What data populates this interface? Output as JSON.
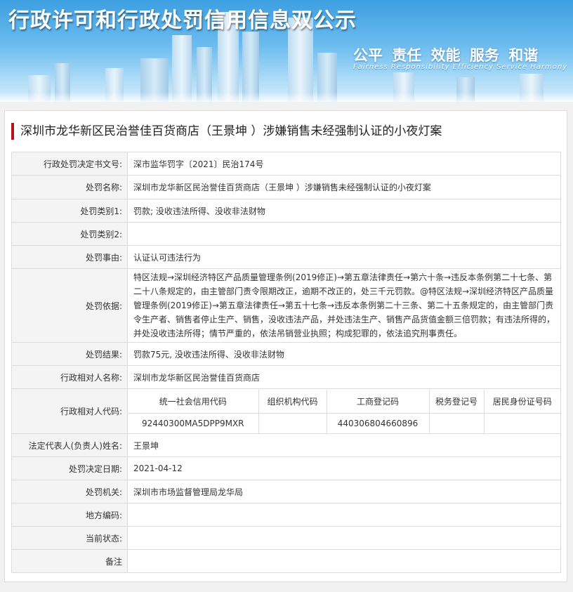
{
  "banner": {
    "title": "行政许可和行政处罚信用信息双公示",
    "slogan": "公平 责任 效能 服务 和谐",
    "slogan_en": "Fairness Responsibility Efficiency Service Harmony"
  },
  "case": {
    "title": "深圳市龙华新区民治誉佳百货商店（王景坤 ）涉嫌销售未经强制认证的小夜灯案",
    "fields": {
      "decision_no": {
        "label": "行政处罚决定书文号:",
        "value": "深市监华罚字〔2021〕民治174号"
      },
      "penalty_name": {
        "label": "处罚名称:",
        "value": "深圳市龙华新区民治誉佳百货商店（王景坤 ）涉嫌销售未经强制认证的小夜灯案"
      },
      "category1": {
        "label": "处罚类别1:",
        "value": "罚款; 没收违法所得、没收非法财物"
      },
      "category2": {
        "label": "处罚类别2:",
        "value": ""
      },
      "reason": {
        "label": "处罚事由:",
        "value": "认证认可违法行为"
      },
      "basis": {
        "label": "处罚依据:",
        "value": "特区法规→深圳经济特区产品质量管理条例(2019修正)→第五章法律责任→第六十条→违反本条例第二十七条、第二十八条规定的，由主管部门责令限期改正，逾期不改正的，处三千元罚款。@特区法规→深圳经济特区产品质量管理条例(2019修正)→第五章法律责任→第五十七条→违反本条例第二十三条、第二十五条规定的，由主管部门责令生产者、销售者停止生产、销售，没收违法产品，并处违法生产、销售产品货值金额三倍罚款；有违法所得的，并处没收违法所得；情节严重的，依法吊销营业执照；构成犯罪的，依法追究刑事责任。"
      },
      "result": {
        "label": "处罚结果:",
        "value": "罚款75元, 没收违法所得、没收非法财物"
      },
      "party_name": {
        "label": "行政相对人名称:",
        "value": "深圳市龙华新区民治誉佳百货商店"
      },
      "party_codes_label": "行政相对人代码:",
      "legal_rep": {
        "label": "法定代表人(负责人)姓名:",
        "value": "王景坤"
      },
      "decision_date": {
        "label": "处罚决定日期:",
        "value": "2021-04-12"
      },
      "authority": {
        "label": "处罚机关:",
        "value": "深圳市市场监督管理局龙华局"
      },
      "region_code": {
        "label": "地方编码:",
        "value": ""
      },
      "status": {
        "label": "当前状态:",
        "value": ""
      },
      "remark": {
        "label": "备注",
        "value": ""
      }
    },
    "codes": {
      "headers": [
        "统一社会信用代码",
        "组织机构代码",
        "工商登记码",
        "税务登记号",
        "居民身份证号码"
      ],
      "values": [
        "92440300MA5DPP9MXR",
        "",
        "440306804660896",
        "",
        ""
      ]
    }
  }
}
